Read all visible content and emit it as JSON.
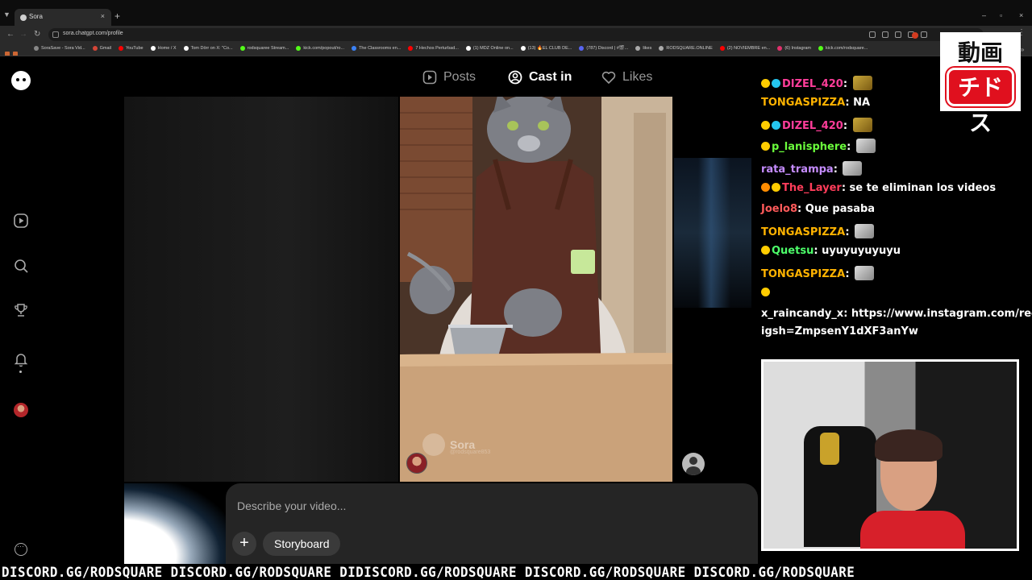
{
  "browser": {
    "tab_title": "Sora",
    "tab_close": "×",
    "new_tab": "+",
    "url": "sora.chatgpt.com/profile",
    "window_controls": [
      "–",
      "▫",
      "×"
    ],
    "bookmarks": [
      {
        "label": "SoraSave - Sora Vid...",
        "color": "#888888"
      },
      {
        "label": "Gmail",
        "color": "#d44638"
      },
      {
        "label": "YouTube",
        "color": "#ff0000"
      },
      {
        "label": "Home / X",
        "color": "#ffffff"
      },
      {
        "label": "Tom Dörr on X: \"Co...",
        "color": "#ffffff"
      },
      {
        "label": "rodsquaree Stream...",
        "color": "#53fc18"
      },
      {
        "label": "kick.com/popout/ro...",
        "color": "#53fc18"
      },
      {
        "label": "The Classrooms en...",
        "color": "#3b82f6"
      },
      {
        "label": "7 Hechos Perturbad...",
        "color": "#ff0000"
      },
      {
        "label": "(1) MDZ Online on...",
        "color": "#ffffff"
      },
      {
        "label": "(13) 🔥EL CLUB DE...",
        "color": "#ffffff"
      },
      {
        "label": "(787) Discord | #🎬...",
        "color": "#5865f2"
      },
      {
        "label": "likes",
        "color": "#aaaaaa"
      },
      {
        "label": "RODSQUARE.ONLINE",
        "color": "#aaaaaa"
      },
      {
        "label": "(2) NOVIEMBRE en...",
        "color": "#ff0000"
      },
      {
        "label": "(6) Instagram",
        "color": "#e1306c"
      },
      {
        "label": "kick.com/rodsquare...",
        "color": "#53fc18"
      }
    ]
  },
  "sidebar": {
    "icons": [
      "logo-icon",
      "video-play-icon",
      "search-icon",
      "trophy-icon",
      "bell-icon",
      "avatar",
      "more-icon"
    ]
  },
  "profile_tabs": [
    {
      "label": "Posts",
      "icon": "play-square-icon"
    },
    {
      "label": "Cast in",
      "icon": "user-circle-icon"
    },
    {
      "label": "Likes",
      "icon": "heart-icon"
    }
  ],
  "video": {
    "watermark": "Sora",
    "handle": "@rodsquare853",
    "actions": [
      "heart-icon",
      "comment-icon",
      "remix-icon",
      "share-icon"
    ]
  },
  "composer": {
    "placeholder": "Describe your video...",
    "plus": "+",
    "storyboard": "Storyboard"
  },
  "chat": [
    {
      "user": "DIZEL_420",
      "color": "#ff3d9a",
      "text": "",
      "emote": "gold",
      "badges": [
        "#ffcc00",
        "#25c6f0"
      ]
    },
    {
      "user": "TONGASPIZZA",
      "color": "#ffb300",
      "text": "NA",
      "emote": "",
      "badges": []
    },
    {
      "user": "DIZEL_420",
      "color": "#ff3d9a",
      "text": "",
      "emote": "gold",
      "badges": [
        "#ffcc00",
        "#25c6f0"
      ]
    },
    {
      "user": "p_lanisphere",
      "color": "#6bff3c",
      "text": "",
      "emote": "grey",
      "badges": [
        "#ffcc00"
      ]
    },
    {
      "user": "rata_trampa",
      "color": "#c58cff",
      "text": "",
      "emote": "grey",
      "badges": []
    },
    {
      "user": "The_Layer",
      "color": "#ff3d5a",
      "text": "se te eliminan los videos",
      "emote": "",
      "badges": [
        "#ff8c00",
        "#ffcc00"
      ]
    },
    {
      "user": "Joelo8",
      "color": "#ff5a5a",
      "text": "Que pasaba",
      "emote": "",
      "badges": []
    },
    {
      "user": "TONGASPIZZA",
      "color": "#ffb300",
      "text": "",
      "emote": "grey",
      "badges": []
    },
    {
      "user": "Quetsu",
      "color": "#4dff6a",
      "text": "uyuyuyuyuyu",
      "emote": "",
      "badges": [
        "#ffcc00"
      ]
    },
    {
      "user": "TONGASPIZZA",
      "color": "#ffb300",
      "text": "",
      "emote": "grey",
      "badges": []
    },
    {
      "user": "",
      "color": "#ffffff",
      "text": "",
      "emote": "",
      "badges": [
        "#ffcc00"
      ]
    },
    {
      "user": "x_raincandy_x",
      "color": "#ffffff",
      "text": "https://www.instagram.com/reel/D",
      "emote": "",
      "badges": []
    },
    {
      "user": "",
      "color": "#ffffff",
      "text": "igsh=ZmpsenY1dXF3anYw",
      "emote": "",
      "badges": []
    }
  ],
  "brand": {
    "top": "動画",
    "bottom": "チドス"
  },
  "ticker": "DISCORD.GG/RODSQUARE DISCORD.GG/RODSQUARE DIDISCORD.GG/RODSQUARE DISCORD.GG/RODSQUARE DISCORD.GG/RODSQUARE"
}
